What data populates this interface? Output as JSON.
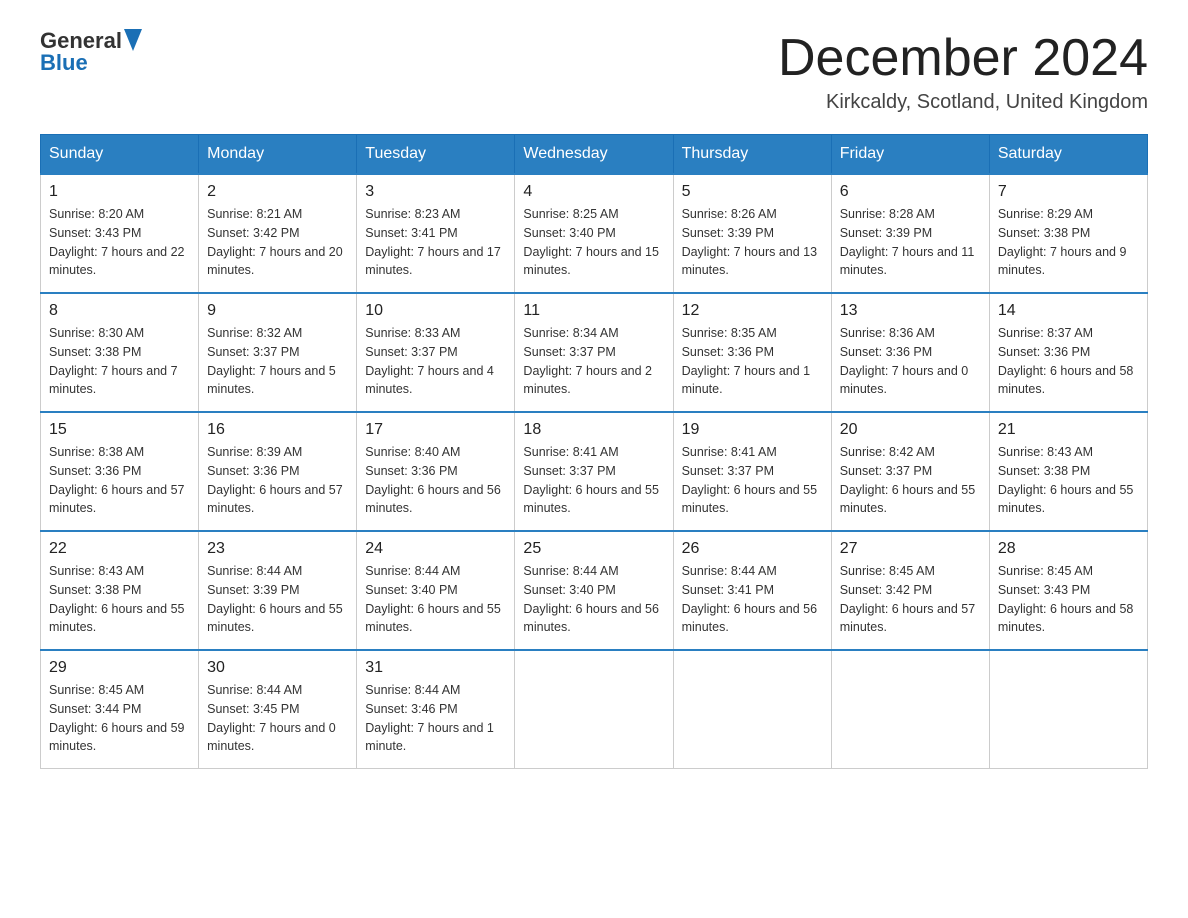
{
  "header": {
    "logo_general": "General",
    "logo_blue": "Blue",
    "month_title": "December 2024",
    "location": "Kirkcaldy, Scotland, United Kingdom"
  },
  "weekdays": [
    "Sunday",
    "Monday",
    "Tuesday",
    "Wednesday",
    "Thursday",
    "Friday",
    "Saturday"
  ],
  "weeks": [
    [
      {
        "day": "1",
        "sunrise": "8:20 AM",
        "sunset": "3:43 PM",
        "daylight": "7 hours and 22 minutes."
      },
      {
        "day": "2",
        "sunrise": "8:21 AM",
        "sunset": "3:42 PM",
        "daylight": "7 hours and 20 minutes."
      },
      {
        "day": "3",
        "sunrise": "8:23 AM",
        "sunset": "3:41 PM",
        "daylight": "7 hours and 17 minutes."
      },
      {
        "day": "4",
        "sunrise": "8:25 AM",
        "sunset": "3:40 PM",
        "daylight": "7 hours and 15 minutes."
      },
      {
        "day": "5",
        "sunrise": "8:26 AM",
        "sunset": "3:39 PM",
        "daylight": "7 hours and 13 minutes."
      },
      {
        "day": "6",
        "sunrise": "8:28 AM",
        "sunset": "3:39 PM",
        "daylight": "7 hours and 11 minutes."
      },
      {
        "day": "7",
        "sunrise": "8:29 AM",
        "sunset": "3:38 PM",
        "daylight": "7 hours and 9 minutes."
      }
    ],
    [
      {
        "day": "8",
        "sunrise": "8:30 AM",
        "sunset": "3:38 PM",
        "daylight": "7 hours and 7 minutes."
      },
      {
        "day": "9",
        "sunrise": "8:32 AM",
        "sunset": "3:37 PM",
        "daylight": "7 hours and 5 minutes."
      },
      {
        "day": "10",
        "sunrise": "8:33 AM",
        "sunset": "3:37 PM",
        "daylight": "7 hours and 4 minutes."
      },
      {
        "day": "11",
        "sunrise": "8:34 AM",
        "sunset": "3:37 PM",
        "daylight": "7 hours and 2 minutes."
      },
      {
        "day": "12",
        "sunrise": "8:35 AM",
        "sunset": "3:36 PM",
        "daylight": "7 hours and 1 minute."
      },
      {
        "day": "13",
        "sunrise": "8:36 AM",
        "sunset": "3:36 PM",
        "daylight": "7 hours and 0 minutes."
      },
      {
        "day": "14",
        "sunrise": "8:37 AM",
        "sunset": "3:36 PM",
        "daylight": "6 hours and 58 minutes."
      }
    ],
    [
      {
        "day": "15",
        "sunrise": "8:38 AM",
        "sunset": "3:36 PM",
        "daylight": "6 hours and 57 minutes."
      },
      {
        "day": "16",
        "sunrise": "8:39 AM",
        "sunset": "3:36 PM",
        "daylight": "6 hours and 57 minutes."
      },
      {
        "day": "17",
        "sunrise": "8:40 AM",
        "sunset": "3:36 PM",
        "daylight": "6 hours and 56 minutes."
      },
      {
        "day": "18",
        "sunrise": "8:41 AM",
        "sunset": "3:37 PM",
        "daylight": "6 hours and 55 minutes."
      },
      {
        "day": "19",
        "sunrise": "8:41 AM",
        "sunset": "3:37 PM",
        "daylight": "6 hours and 55 minutes."
      },
      {
        "day": "20",
        "sunrise": "8:42 AM",
        "sunset": "3:37 PM",
        "daylight": "6 hours and 55 minutes."
      },
      {
        "day": "21",
        "sunrise": "8:43 AM",
        "sunset": "3:38 PM",
        "daylight": "6 hours and 55 minutes."
      }
    ],
    [
      {
        "day": "22",
        "sunrise": "8:43 AM",
        "sunset": "3:38 PM",
        "daylight": "6 hours and 55 minutes."
      },
      {
        "day": "23",
        "sunrise": "8:44 AM",
        "sunset": "3:39 PM",
        "daylight": "6 hours and 55 minutes."
      },
      {
        "day": "24",
        "sunrise": "8:44 AM",
        "sunset": "3:40 PM",
        "daylight": "6 hours and 55 minutes."
      },
      {
        "day": "25",
        "sunrise": "8:44 AM",
        "sunset": "3:40 PM",
        "daylight": "6 hours and 56 minutes."
      },
      {
        "day": "26",
        "sunrise": "8:44 AM",
        "sunset": "3:41 PM",
        "daylight": "6 hours and 56 minutes."
      },
      {
        "day": "27",
        "sunrise": "8:45 AM",
        "sunset": "3:42 PM",
        "daylight": "6 hours and 57 minutes."
      },
      {
        "day": "28",
        "sunrise": "8:45 AM",
        "sunset": "3:43 PM",
        "daylight": "6 hours and 58 minutes."
      }
    ],
    [
      {
        "day": "29",
        "sunrise": "8:45 AM",
        "sunset": "3:44 PM",
        "daylight": "6 hours and 59 minutes."
      },
      {
        "day": "30",
        "sunrise": "8:44 AM",
        "sunset": "3:45 PM",
        "daylight": "7 hours and 0 minutes."
      },
      {
        "day": "31",
        "sunrise": "8:44 AM",
        "sunset": "3:46 PM",
        "daylight": "7 hours and 1 minute."
      },
      null,
      null,
      null,
      null
    ]
  ]
}
